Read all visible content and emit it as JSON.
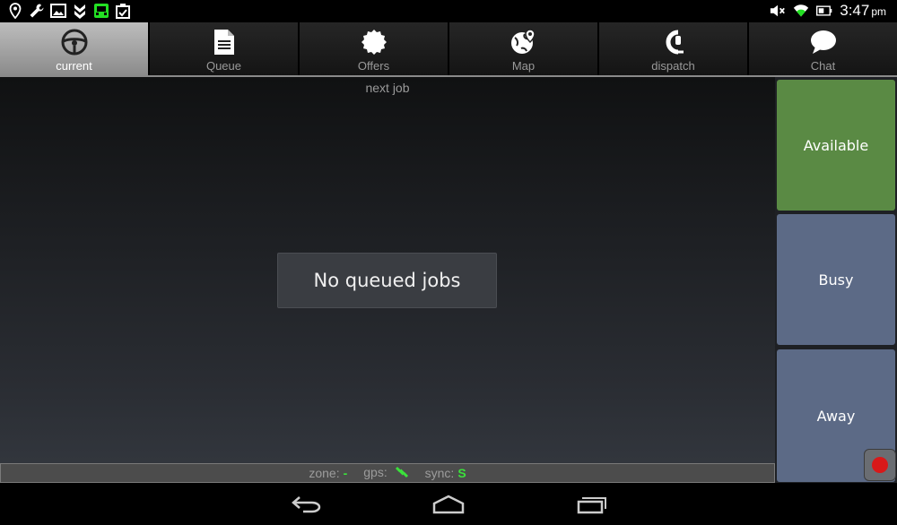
{
  "status_bar": {
    "time": "3:47",
    "ampm": "pm",
    "left_icons": [
      "location-icon",
      "wrench-icon",
      "image-icon",
      "download-icon",
      "taxi-icon",
      "clipboard-icon"
    ],
    "right_icons": [
      "mute-icon",
      "wifi-icon",
      "battery-icon"
    ],
    "colors": {
      "taxi_icon": "#23e023"
    }
  },
  "tabs": [
    {
      "label": "current",
      "icon": "steering-wheel-icon",
      "active": true
    },
    {
      "label": "Queue",
      "icon": "document-icon",
      "active": false
    },
    {
      "label": "Offers",
      "icon": "badge-icon",
      "active": false
    },
    {
      "label": "Map",
      "icon": "globe-pin-icon",
      "active": false
    },
    {
      "label": "dispatch",
      "icon": "headset-icon",
      "active": false
    },
    {
      "label": "Chat",
      "icon": "speech-bubble-icon",
      "active": false
    }
  ],
  "main": {
    "heading": "next job",
    "message": "No queued jobs"
  },
  "footer": {
    "zone_label": "zone:",
    "zone_value": "-",
    "gps_label": "gps:",
    "sync_label": "sync:",
    "sync_value": "S"
  },
  "status_buttons": {
    "available": "Available",
    "busy": "Busy",
    "away": "Away"
  },
  "colors": {
    "available": "#5a8a44",
    "busy": "#5c6a86",
    "away": "#5c6a86",
    "record": "#d81919",
    "indicator": "#3be03b"
  },
  "nav": [
    "back-icon",
    "home-icon",
    "recent-apps-icon"
  ]
}
